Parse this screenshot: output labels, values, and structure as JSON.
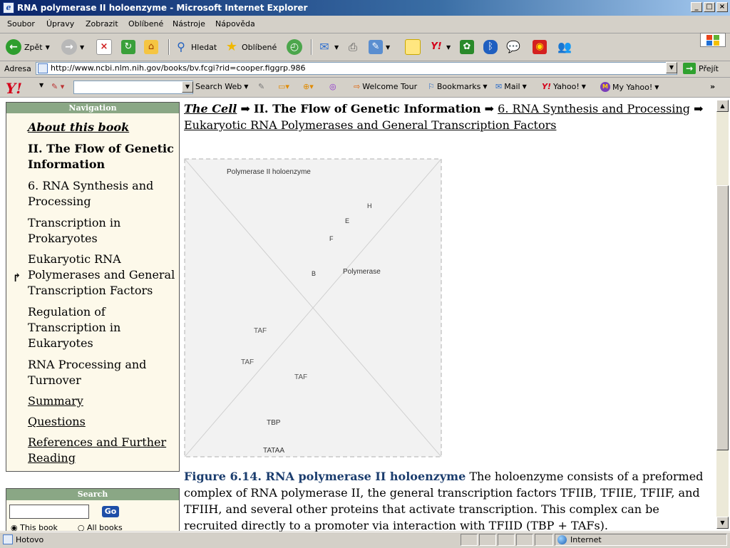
{
  "window": {
    "title": "RNA polymerase II holoenzyme - Microsoft Internet Explorer"
  },
  "menu": [
    "Soubor",
    "Úpravy",
    "Zobrazit",
    "Oblíbené",
    "Nástroje",
    "Nápověda"
  ],
  "toolbar": {
    "back": "Zpět",
    "search": "Hledat",
    "favorites": "Oblíbené"
  },
  "address": {
    "label": "Adresa",
    "url": "http://www.ncbi.nlm.nih.gov/books/bv.fcgi?rid=cooper.figgrp.986",
    "go": "Přejít"
  },
  "yahoo": {
    "search_web": "Search Web",
    "welcome_tour": "Welcome Tour",
    "bookmarks": "Bookmarks",
    "mail": "Mail",
    "yahoo": "Yahoo!",
    "my_yahoo": "My Yahoo!",
    "more": "»"
  },
  "nav": {
    "header": "Navigation",
    "items": [
      "About this book",
      "II. The Flow of Genetic Information",
      "6. RNA Synthesis and Processing",
      "Transcription in Prokaryotes",
      "Eukaryotic RNA Polymerases and General Transcription Factors",
      "Regulation of Transcription in Eukaryotes",
      "RNA Processing and Turnover",
      "Summary",
      "Questions",
      "References and Further Reading"
    ]
  },
  "search": {
    "header": "Search",
    "go": "Go",
    "radio1": "This book",
    "radio2": "All books"
  },
  "breadcrumb": {
    "book": "The Cell",
    "part": "II. The Flow of Genetic Information",
    "chapter": "6. RNA Synthesis and Processing",
    "section": "Eukaryotic RNA Polymerases and General Transcription Factors"
  },
  "figure": {
    "labels": {
      "holoenzyme": "Polymerase II holoenzyme",
      "h": "H",
      "e": "E",
      "f": "F",
      "b": "B",
      "polymerase": "Polymerase",
      "taf": "TAF",
      "tbp": "TBP",
      "tataa": "TATAA"
    }
  },
  "caption": {
    "title": "Figure 6.14. RNA polymerase II holoenzyme",
    "text": "The holoenzyme consists of a preformed complex of RNA polymerase II, the general transcription factors TFIIB, TFIIE, TFIIF, and TFIIH, and several other proteins that activate transcription. This complex can be recruited directly to a promoter via interaction with TFIID (TBP + TAFs)."
  },
  "status": {
    "text": "Hotovo",
    "zone": "Internet"
  }
}
